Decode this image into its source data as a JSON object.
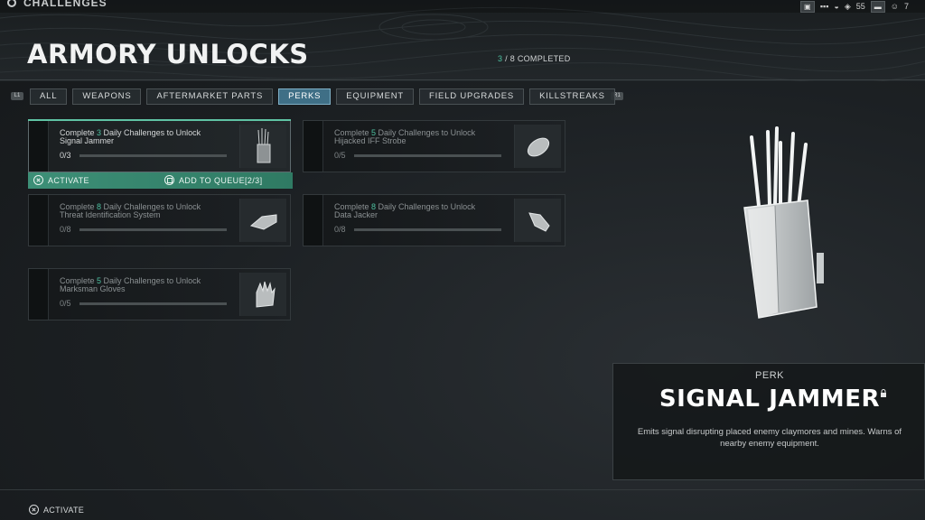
{
  "header": {
    "breadcrumb": "CHALLENGES",
    "title": "ARMORY UNLOCKS",
    "progress_done": "3",
    "progress_rest": " / 8 COMPLETED",
    "hud_level": "55",
    "hud_count": "7"
  },
  "tabs": [
    {
      "label": "ALL",
      "active": false
    },
    {
      "label": "WEAPONS",
      "active": false
    },
    {
      "label": "AFTERMARKET PARTS",
      "active": false
    },
    {
      "label": "PERKS",
      "active": true
    },
    {
      "label": "EQUIPMENT",
      "active": false
    },
    {
      "label": "FIELD UPGRADES",
      "active": false
    },
    {
      "label": "KILLSTREAKS",
      "active": false
    }
  ],
  "bumpers": {
    "left": "L1",
    "right": "R1"
  },
  "cards": [
    {
      "pre": "Complete ",
      "num": "3",
      "post": " Daily Challenges to Unlock",
      "item": "Signal Jammer",
      "count": "0/3",
      "progress": 0,
      "icon": "signal-jammer-icon"
    },
    {
      "pre": "Complete ",
      "num": "5",
      "post": " Daily Challenges to Unlock",
      "item": "Hijacked IFF Strobe",
      "count": "0/5",
      "progress": 0,
      "icon": "iff-strobe-icon"
    },
    {
      "pre": "Complete ",
      "num": "8",
      "post": " Daily Challenges to Unlock",
      "item": "Threat Identification System",
      "count": "0/8",
      "progress": 0,
      "icon": "threat-id-icon"
    },
    {
      "pre": "Complete ",
      "num": "8",
      "post": " Daily Challenges to Unlock",
      "item": "Data Jacker",
      "count": "0/8",
      "progress": 0,
      "icon": "data-jacker-icon"
    },
    {
      "pre": "Complete ",
      "num": "5",
      "post": " Daily Challenges to Unlock",
      "item": "Marksman Gloves",
      "count": "0/5",
      "progress": 0,
      "icon": "gloves-icon"
    }
  ],
  "actions": {
    "activate": "ACTIVATE",
    "queue": "ADD TO QUEUE[2/3]"
  },
  "detail": {
    "category": "PERK",
    "name": "SIGNAL JAMMER",
    "description": "Emits signal disrupting placed enemy claymores and mines. Warns of nearby enemy equipment."
  },
  "footer": {
    "activate": "ACTIVATE"
  },
  "colors": {
    "accent": "#4dc0a0",
    "tab_active": "#3f6f86"
  }
}
